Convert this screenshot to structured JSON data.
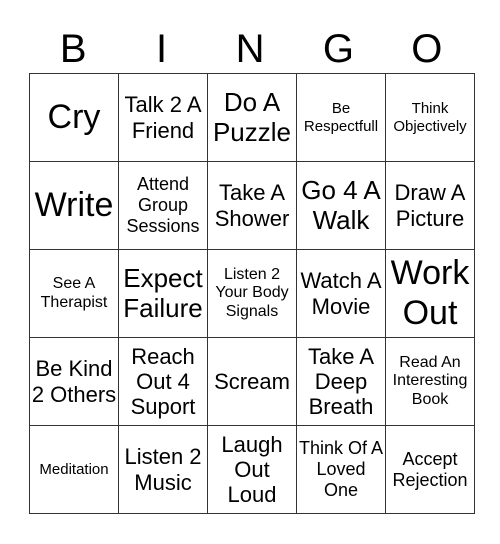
{
  "header": [
    "B",
    "I",
    "N",
    "G",
    "O"
  ],
  "rows": [
    [
      {
        "text": "Cry",
        "size": "s1"
      },
      {
        "text": "Talk 2 A Friend",
        "size": "s3"
      },
      {
        "text": "Do A Puzzle",
        "size": "s2"
      },
      {
        "text": "Be Respectfull",
        "size": "s6"
      },
      {
        "text": "Think Objectively",
        "size": "s6"
      }
    ],
    [
      {
        "text": "Write",
        "size": "s1"
      },
      {
        "text": "Attend Group Sessions",
        "size": "s4"
      },
      {
        "text": "Take A Shower",
        "size": "s3"
      },
      {
        "text": "Go 4 A Walk",
        "size": "s2"
      },
      {
        "text": "Draw A Picture",
        "size": "s3"
      }
    ],
    [
      {
        "text": "See A Therapist",
        "size": "s5"
      },
      {
        "text": "Expect Failure",
        "size": "s2"
      },
      {
        "text": "Listen 2 Your Body Signals",
        "size": "s5"
      },
      {
        "text": "Watch A Movie",
        "size": "s3"
      },
      {
        "text": "Work Out",
        "size": "s1"
      }
    ],
    [
      {
        "text": "Be Kind 2 Others",
        "size": "s3"
      },
      {
        "text": "Reach Out 4 Suport",
        "size": "s3"
      },
      {
        "text": "Scream",
        "size": "s3"
      },
      {
        "text": "Take A Deep Breath",
        "size": "s3"
      },
      {
        "text": "Read An Interesting Book",
        "size": "s5"
      }
    ],
    [
      {
        "text": "Meditation",
        "size": "s6"
      },
      {
        "text": "Listen 2 Music",
        "size": "s3"
      },
      {
        "text": "Laugh Out Loud",
        "size": "s3"
      },
      {
        "text": "Think Of A Loved One",
        "size": "s4"
      },
      {
        "text": "Accept Rejection",
        "size": "s4"
      }
    ]
  ]
}
